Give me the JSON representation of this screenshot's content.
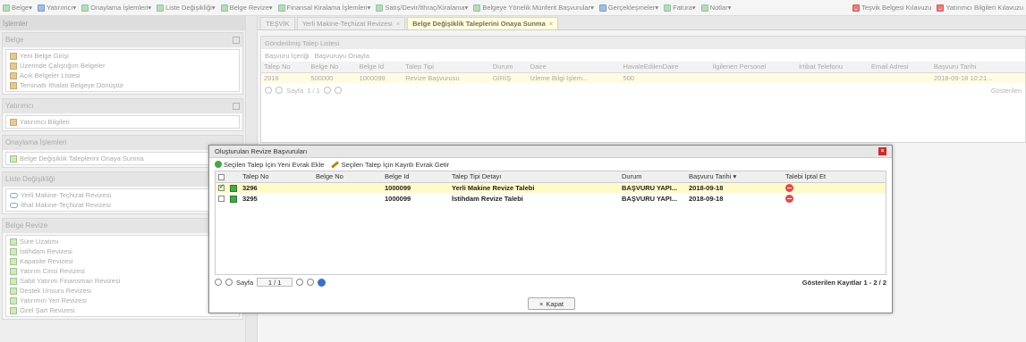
{
  "menubar": {
    "items": [
      "Belge",
      "Yatırımcı",
      "Onaylama İşlemleri",
      "Liste Değişikliği",
      "Belge Revize",
      "Finansal Kiralama İşlemleri",
      "Satış/Devir/İthraç/Kiralama",
      "Belgeye Yönelik Münferit Başvurular",
      "Gerçekleşmeler",
      "Fatura",
      "Notlar"
    ],
    "right": [
      "Teşvik Belgesi Kılavuzu",
      "Yatırımcı Bilgileri Kılavuzu"
    ]
  },
  "left": {
    "title": "İşlemler",
    "belge": {
      "header": "Belge",
      "items": [
        "Yeni Belge Girişi",
        "Üzerinde Çalıştığım Belgeler",
        "Açık Belgeler Listesi",
        "Teminatlı İthalatı Belgeye Dönüştür"
      ]
    },
    "yatirimci": {
      "header": "Yatırımcı",
      "items": [
        "Yatırımcı Bilgileri"
      ]
    },
    "onaylama": {
      "header": "Onaylama İşlemleri",
      "items": [
        "Belge Değişiklik Taleplerini Onaya Sunma"
      ]
    },
    "liste": {
      "header": "Liste Değişikliği",
      "items": [
        "Yerli Makine-Teçhizat Revizesi",
        "İthal Makine-Teçhizat Revizesi"
      ]
    },
    "revize": {
      "header": "Belge Revize",
      "items": [
        "Süre Uzatımı",
        "İstihdam Revizesi",
        "Kapasite Revizesi",
        "Yatırım Cinsi Revizesi",
        "Sabit Yatırım Finansman Revizesi",
        "Destek Unsuru Revizesi",
        "Yatırımın Yeri Revizesi",
        "Özel Şart Revizesi"
      ]
    }
  },
  "tabs": [
    "TEŞVİK",
    "Yerli Makine-Teçhizat Revizesi",
    "Belge Değişiklik Taleplerini Onaya Sunma"
  ],
  "panel": {
    "title": "Gönderilmiş Talep Listesi",
    "tool1": "Başvuru İçeriği",
    "tool2": "Başvuruyu Onayla",
    "columns": [
      "Talep No",
      "Belge No",
      "Belge Id",
      "Talep Tipi",
      "Durum",
      "Daire",
      "HavaleEdilenDaire",
      "İlgilenen Personel",
      "İrtibat Telefonu",
      "Email Adresi",
      "Başvuru Tarihi"
    ],
    "row": [
      "2916",
      "500000",
      "1000099",
      "Revize Başvurusu",
      "GİRİŞ",
      "İzleme Bilgi İşlem...",
      "500",
      "",
      "",
      "",
      "2018-09-18 10:21..."
    ],
    "pager_label": "Sayfa",
    "pager_value": "1 / 1",
    "shown": "Gösterilen"
  },
  "modal": {
    "title": "Oluşturulan Revize Başvuruları",
    "tool1": "Seçilen Talep İçin Yeni Evrak Ekle",
    "tool2": "Seçilen Talep İçin Kayıtlı Evrak Getir",
    "columns": [
      "Talep No",
      "Belge No",
      "Belge Id",
      "Talep Tipi Detayı",
      "Durum",
      "Başvuru Tarihi",
      "Talebi İptal Et"
    ],
    "rows": [
      [
        "3296",
        "",
        "1000099",
        "Yerli Makine Revize Talebi",
        "BAŞVURU YAPI...",
        "2018-09-18"
      ],
      [
        "3295",
        "",
        "1000099",
        "İstihdam Revize Talebi",
        "BAŞVURU YAPI...",
        "2018-09-18"
      ]
    ],
    "pager_label": "Sayfa",
    "pager_value": "1 / 1",
    "shown": "Gösterilen Kayıtlar 1 - 2 / 2",
    "close": "Kapat"
  },
  "colors": {
    "accent": "#f0a030",
    "selected": "#fffbc8"
  }
}
